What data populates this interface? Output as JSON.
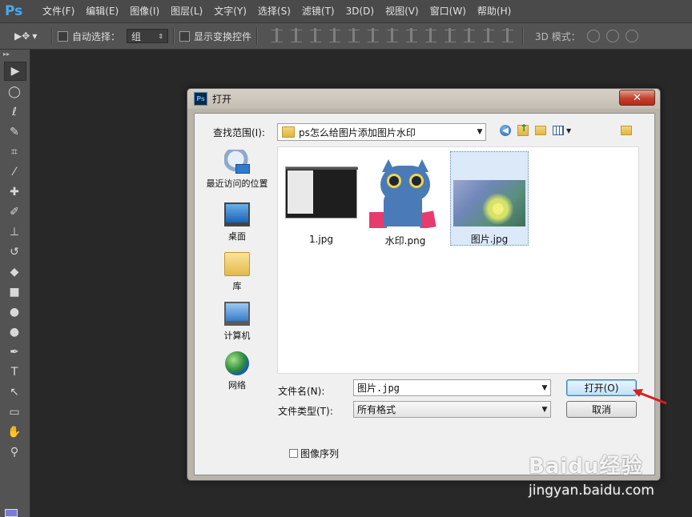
{
  "app": {
    "logo": "Ps"
  },
  "menu": [
    "文件(F)",
    "编辑(E)",
    "图像(I)",
    "图层(L)",
    "文字(Y)",
    "选择(S)",
    "滤镜(T)",
    "3D(D)",
    "视图(V)",
    "窗口(W)",
    "帮助(H)"
  ],
  "options": {
    "move_glyph": "▶✥",
    "auto_select_label": "自动选择：",
    "auto_select_value": "组",
    "show_transform_label": "显示变换控件",
    "mode_label": "3D 模式："
  },
  "dialog": {
    "title": "打开",
    "ps_icon": "Ps",
    "close": "✕",
    "look_in_label": "查找范围(I):",
    "look_in_value": "ps怎么给图片添加图片水印",
    "places": [
      {
        "label": "最近访问的位置",
        "icon": "recent-places-icon"
      },
      {
        "label": "桌面",
        "icon": "desktop-icon"
      },
      {
        "label": "库",
        "icon": "library-icon"
      },
      {
        "label": "计算机",
        "icon": "computer-icon"
      },
      {
        "label": "网络",
        "icon": "network-icon"
      }
    ],
    "files": [
      {
        "name": "1.jpg",
        "selected": false
      },
      {
        "name": "水印.png",
        "selected": false
      },
      {
        "name": "图片.jpg",
        "selected": true
      }
    ],
    "filename_label": "文件名(N):",
    "filename_value": "图片.jpg",
    "filetype_label": "文件类型(T):",
    "filetype_value": "所有格式",
    "open_button": "打开(O)",
    "cancel_button": "取消",
    "image_sequence_label": "图像序列"
  },
  "watermark": {
    "top": "Baidu经验",
    "bottom": "jingyan.baidu.com"
  },
  "colors": {
    "accent": "#4fb1f5",
    "arrow": "#d81e1e",
    "foreground_swatch": "#7a7ad8"
  }
}
